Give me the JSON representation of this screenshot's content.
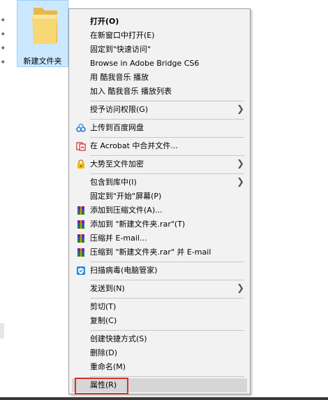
{
  "desktop": {
    "folder_label": "新建文件夹"
  },
  "menu": {
    "open": "打开(O)",
    "open_new_window": "在新窗口中打开(E)",
    "pin_quick_access": "固定到\"快速访问\"",
    "browse_bridge": "Browse in Adobe Bridge CS6",
    "play_kugou": "用 酷我音乐 播放",
    "add_kugou_playlist": "加入 酷我音乐 播放列表",
    "grant_access": "授予访问权限(G)",
    "upload_baidu": "上传到百度网盘",
    "acrobat_merge": "在 Acrobat 中合并文件...",
    "dashi_encrypt": "大势至文件加密",
    "include_library": "包含到库中(I)",
    "pin_start": "固定到\"开始\"屏幕(P)",
    "add_archive": "添加到压缩文件(A)...",
    "add_rar": "添加到 \"新建文件夹.rar\"(T)",
    "compress_email": "压缩并 E-mail...",
    "compress_rar_email": "压缩到 \"新建文件夹.rar\" 并 E-mail",
    "scan_virus": "扫描病毒(电脑管家)",
    "send_to": "发送到(N)",
    "cut": "剪切(T)",
    "copy": "复制(C)",
    "create_shortcut": "创建快捷方式(S)",
    "delete": "删除(D)",
    "rename": "重命名(M)",
    "properties": "属性(R)"
  },
  "colors": {
    "menu_bg": "#f2f2f2",
    "highlight": "#d6d6d6",
    "annotation": "#d9302c",
    "selection": "#cce8ff"
  }
}
